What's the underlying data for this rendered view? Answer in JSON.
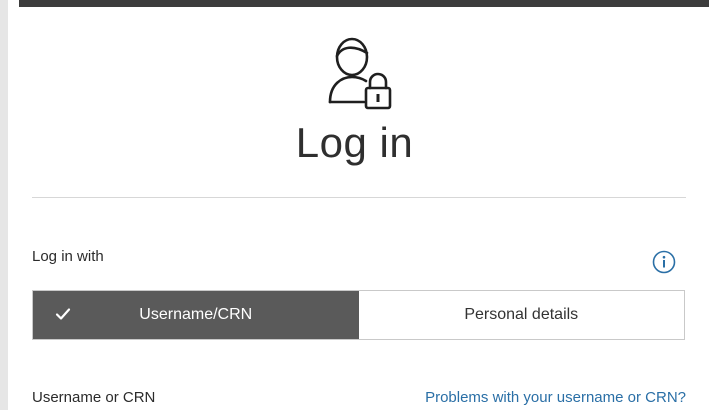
{
  "title": "Log in",
  "login_with": {
    "label": "Log in with",
    "info_icon": "info-icon",
    "options": [
      {
        "label": "Username/CRN",
        "selected": true,
        "icon": "check-icon"
      },
      {
        "label": "Personal details",
        "selected": false
      }
    ]
  },
  "username_field": {
    "label": "Username or CRN",
    "help_link": "Problems with your username or CRN?"
  },
  "icons": {
    "header_icon": "user-lock-icon"
  },
  "colors": {
    "selected_bg": "#5a5a5a",
    "link": "#2a6fa6",
    "info_icon": "#2a6fa6",
    "top_bar": "#3c3c3c"
  }
}
